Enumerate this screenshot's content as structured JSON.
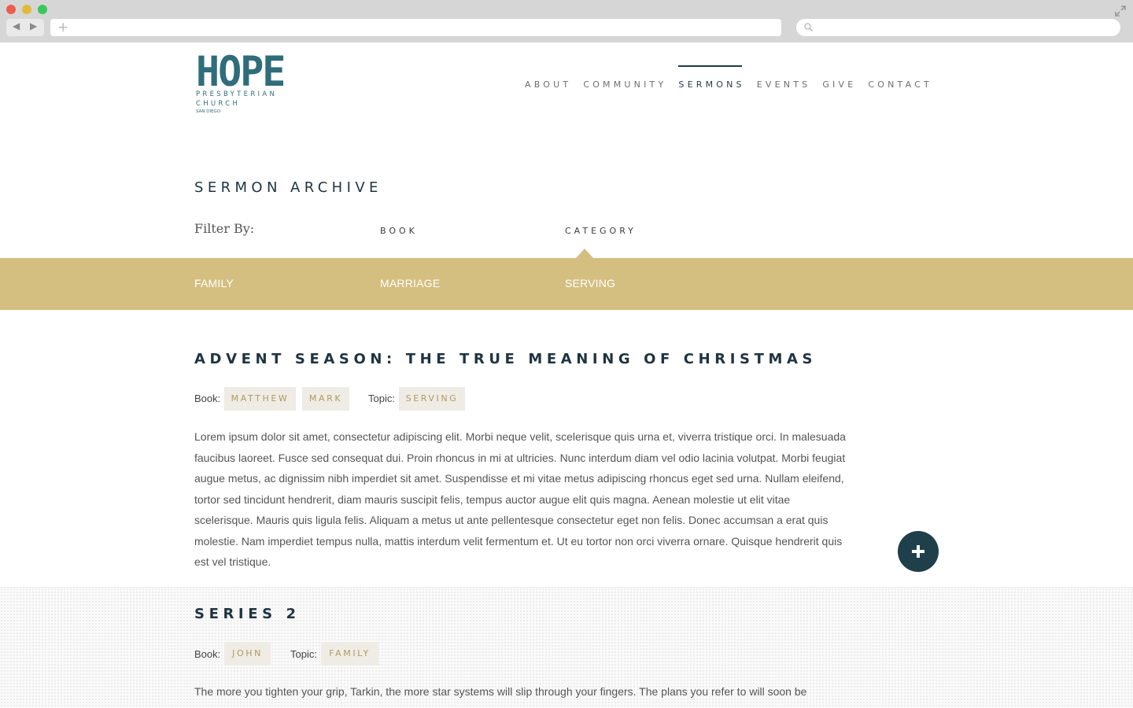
{
  "nav": {
    "items": [
      {
        "label": "ABOUT",
        "active": false
      },
      {
        "label": "COMMUNITY",
        "active": false
      },
      {
        "label": "SERMONS",
        "active": true
      },
      {
        "label": "EVENTS",
        "active": false
      },
      {
        "label": "GIVE",
        "active": false
      },
      {
        "label": "CONTACT",
        "active": false
      }
    ]
  },
  "logo": {
    "main": "HOPE",
    "line1": "PRESBYTERIAN",
    "line2": "CHURCH",
    "line3": "SAN DIEGO"
  },
  "archive": {
    "title": "SERMON ARCHIVE",
    "filter_label": "Filter By:",
    "tabs": [
      "BOOK",
      "CATEGORY"
    ],
    "active_tab": "CATEGORY",
    "categories": [
      "FAMILY",
      "MARRIAGE",
      "SERVING"
    ]
  },
  "sermons": [
    {
      "title": "ADVENT SEASON: THE TRUE MEANING OF CHRISTMAS",
      "book_label": "Book:",
      "books": [
        "MATTHEW",
        "MARK"
      ],
      "topic_label": "Topic:",
      "topics": [
        "SERVING"
      ],
      "body": "Lorem ipsum dolor sit amet, consectetur adipiscing elit. Morbi neque velit, scelerisque quis urna et, viverra tristique orci. In malesuada faucibus laoreet. Fusce sed consequat dui. Proin rhoncus in mi at ultricies. Nunc interdum diam vel odio lacinia volutpat. Morbi feugiat augue metus, ac dignissim nibh imperdiet sit amet. Suspendisse et mi vitae metus adipiscing rhoncus eget sed urna. Nullam eleifend, tortor sed tincidunt hendrerit, diam mauris suscipit felis, tempus auctor augue elit quis magna. Aenean molestie ut elit vitae scelerisque. Mauris quis ligula felis. Aliquam a metus ut ante pellentesque consectetur eget non felis. Donec accumsan a erat quis molestie. Nam imperdiet tempus nulla, mattis interdum velit fermentum et. Ut eu tortor non orci viverra ornare. Quisque hendrerit quis est vel tristique."
    },
    {
      "title": "SERIES 2",
      "book_label": "Book:",
      "books": [
        "JOHN"
      ],
      "topic_label": "Topic:",
      "topics": [
        "FAMILY"
      ],
      "body": "The more you tighten your grip, Tarkin, the more star systems will slip through your fingers. The plans you refer to will soon be"
    }
  ],
  "colors": {
    "accent": "#d4bf80",
    "navy": "#1f3f4b",
    "logo": "#2f6d7a"
  }
}
